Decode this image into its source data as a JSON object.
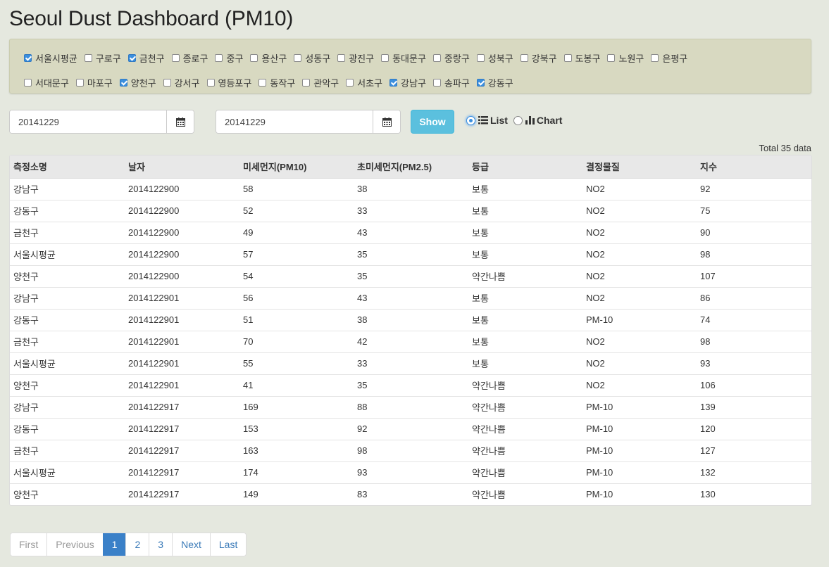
{
  "title": "Seoul Dust Dashboard (PM10)",
  "districts": {
    "row1": [
      {
        "label": "서울시평균",
        "checked": true
      },
      {
        "label": "구로구",
        "checked": false
      },
      {
        "label": "금천구",
        "checked": true
      },
      {
        "label": "종로구",
        "checked": false
      },
      {
        "label": "중구",
        "checked": false
      },
      {
        "label": "용산구",
        "checked": false
      },
      {
        "label": "성동구",
        "checked": false
      },
      {
        "label": "광진구",
        "checked": false
      },
      {
        "label": "동대문구",
        "checked": false
      },
      {
        "label": "중랑구",
        "checked": false
      },
      {
        "label": "성북구",
        "checked": false
      },
      {
        "label": "강북구",
        "checked": false
      },
      {
        "label": "도봉구",
        "checked": false
      },
      {
        "label": "노원구",
        "checked": false
      },
      {
        "label": "은평구",
        "checked": false
      }
    ],
    "row2": [
      {
        "label": "서대문구",
        "checked": false
      },
      {
        "label": "마포구",
        "checked": false
      },
      {
        "label": "양천구",
        "checked": true
      },
      {
        "label": "강서구",
        "checked": false
      },
      {
        "label": "영등포구",
        "checked": false
      },
      {
        "label": "동작구",
        "checked": false
      },
      {
        "label": "관악구",
        "checked": false
      },
      {
        "label": "서초구",
        "checked": false
      },
      {
        "label": "강남구",
        "checked": true
      },
      {
        "label": "송파구",
        "checked": false
      },
      {
        "label": "강동구",
        "checked": true
      }
    ]
  },
  "controls": {
    "start_date": "20141229",
    "end_date": "20141229",
    "show_label": "Show",
    "list_label": "List",
    "chart_label": "Chart",
    "view_mode": "list"
  },
  "total_label": "Total 35 data",
  "table": {
    "headers": [
      "측정소명",
      "날자",
      "미세먼지(PM10)",
      "초미세먼지(PM2.5)",
      "등급",
      "결정물질",
      "지수"
    ],
    "rows": [
      [
        "강남구",
        "2014122900",
        "58",
        "38",
        "보통",
        "NO2",
        "92"
      ],
      [
        "강동구",
        "2014122900",
        "52",
        "33",
        "보통",
        "NO2",
        "75"
      ],
      [
        "금천구",
        "2014122900",
        "49",
        "43",
        "보통",
        "NO2",
        "90"
      ],
      [
        "서울시평균",
        "2014122900",
        "57",
        "35",
        "보통",
        "NO2",
        "98"
      ],
      [
        "양천구",
        "2014122900",
        "54",
        "35",
        "약간나쁨",
        "NO2",
        "107"
      ],
      [
        "강남구",
        "2014122901",
        "56",
        "43",
        "보통",
        "NO2",
        "86"
      ],
      [
        "강동구",
        "2014122901",
        "51",
        "38",
        "보통",
        "PM-10",
        "74"
      ],
      [
        "금천구",
        "2014122901",
        "70",
        "42",
        "보통",
        "NO2",
        "98"
      ],
      [
        "서울시평균",
        "2014122901",
        "55",
        "33",
        "보통",
        "NO2",
        "93"
      ],
      [
        "양천구",
        "2014122901",
        "41",
        "35",
        "약간나쁨",
        "NO2",
        "106"
      ],
      [
        "강남구",
        "2014122917",
        "169",
        "88",
        "약간나쁨",
        "PM-10",
        "139"
      ],
      [
        "강동구",
        "2014122917",
        "153",
        "92",
        "약간나쁨",
        "PM-10",
        "120"
      ],
      [
        "금천구",
        "2014122917",
        "163",
        "98",
        "약간나쁨",
        "PM-10",
        "127"
      ],
      [
        "서울시평균",
        "2014122917",
        "174",
        "93",
        "약간나쁨",
        "PM-10",
        "132"
      ],
      [
        "양천구",
        "2014122917",
        "149",
        "83",
        "약간나쁨",
        "PM-10",
        "130"
      ]
    ]
  },
  "pagination": {
    "items": [
      {
        "label": "First",
        "state": "disabled"
      },
      {
        "label": "Previous",
        "state": "disabled"
      },
      {
        "label": "1",
        "state": "active"
      },
      {
        "label": "2",
        "state": "normal"
      },
      {
        "label": "3",
        "state": "normal"
      },
      {
        "label": "Next",
        "state": "normal"
      },
      {
        "label": "Last",
        "state": "normal"
      }
    ]
  },
  "colors": {
    "accent": "#3b8fde",
    "show_button": "#5bc0de",
    "background": "#e5e8df",
    "panel": "#d8d9c1"
  }
}
